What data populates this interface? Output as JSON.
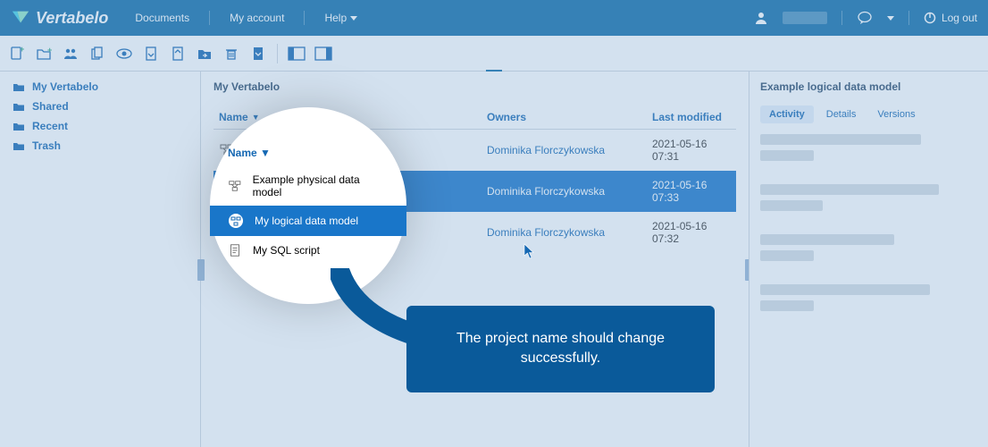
{
  "brand": "Vertabelo",
  "topnav": {
    "documents": "Documents",
    "account": "My account",
    "help": "Help"
  },
  "topright": {
    "logout": "Log out"
  },
  "sidebar": {
    "items": [
      {
        "label": "My Vertabelo"
      },
      {
        "label": "Shared"
      },
      {
        "label": "Recent"
      },
      {
        "label": "Trash"
      }
    ]
  },
  "main": {
    "title": "My Vertabelo",
    "columns": {
      "name": "Name",
      "sort": "▼",
      "owners": "Owners",
      "modified": "Last modified"
    },
    "rows": [
      {
        "name": "Example physical data model",
        "owner": "Dominika Florczykowska",
        "modified": "2021-05-16 07:31",
        "selected": false,
        "icon": "physical"
      },
      {
        "name": "My logical data model",
        "owner": "Dominika Florczykowska",
        "modified": "2021-05-16 07:33",
        "selected": true,
        "icon": "logical"
      },
      {
        "name": "My SQL script",
        "owner": "Dominika Florczykowska",
        "modified": "2021-05-16 07:32",
        "selected": false,
        "icon": "sql"
      }
    ]
  },
  "right": {
    "title": "Example logical data model",
    "tabs": {
      "activity": "Activity",
      "details": "Details",
      "versions": "Versions"
    }
  },
  "callout": {
    "text": "The project name should change successfully."
  },
  "spotlight": {
    "head": "Name ▼",
    "rows": [
      {
        "name": "Example physical data model",
        "icon": "physical",
        "sel": false
      },
      {
        "name": "My logical data model",
        "icon": "logical",
        "sel": true
      },
      {
        "name": "My SQL script",
        "icon": "sql",
        "sel": false
      }
    ]
  }
}
